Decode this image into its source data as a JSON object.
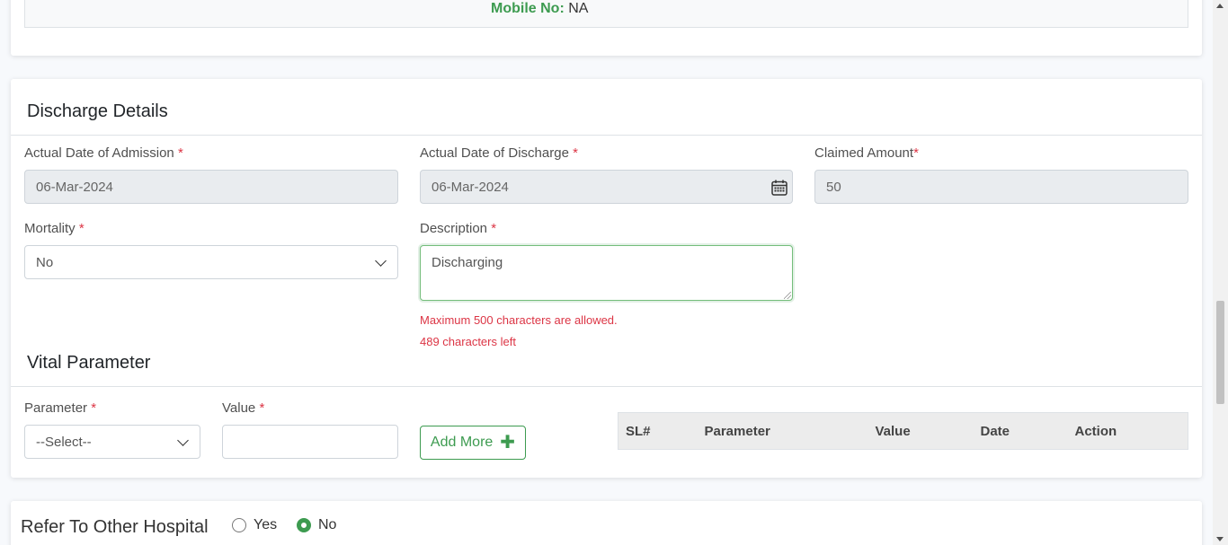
{
  "patient_info": {
    "mobile_label": "Mobile No:",
    "mobile_value": "NA"
  },
  "discharge": {
    "title": "Discharge Details",
    "admission_date": {
      "label": "Actual Date of Admission",
      "required": "*",
      "value": "06-Mar-2024"
    },
    "discharge_date": {
      "label": "Actual Date of Discharge",
      "required": "*",
      "value": "06-Mar-2024",
      "icon": "calendar-icon"
    },
    "claimed_amount": {
      "label": "Claimed Amount",
      "required": "*",
      "value": "50"
    },
    "mortality": {
      "label": "Mortality",
      "required": "*",
      "selected": "No"
    },
    "description": {
      "label": "Description",
      "required": "*",
      "value": "Discharging",
      "max_note": "Maximum 500 characters are allowed.",
      "chars_left": "489 characters left"
    }
  },
  "vital": {
    "title": "Vital Parameter",
    "parameter": {
      "label": "Parameter",
      "required": "*",
      "selected": "--Select--"
    },
    "value": {
      "label": "Value",
      "required": "*",
      "input_value": ""
    },
    "add_more_label": "Add More",
    "add_icon": "plus-icon",
    "table_headers": [
      "SL#",
      "Parameter",
      "Value",
      "Date",
      "Action"
    ]
  },
  "refer": {
    "title": "Refer To Other Hospital",
    "options": [
      {
        "label": "Yes",
        "checked": false
      },
      {
        "label": "No",
        "checked": true
      }
    ]
  },
  "colors": {
    "accent": "#3d9b50",
    "required": "#dc3545",
    "disabled_bg": "#e9ecef"
  }
}
